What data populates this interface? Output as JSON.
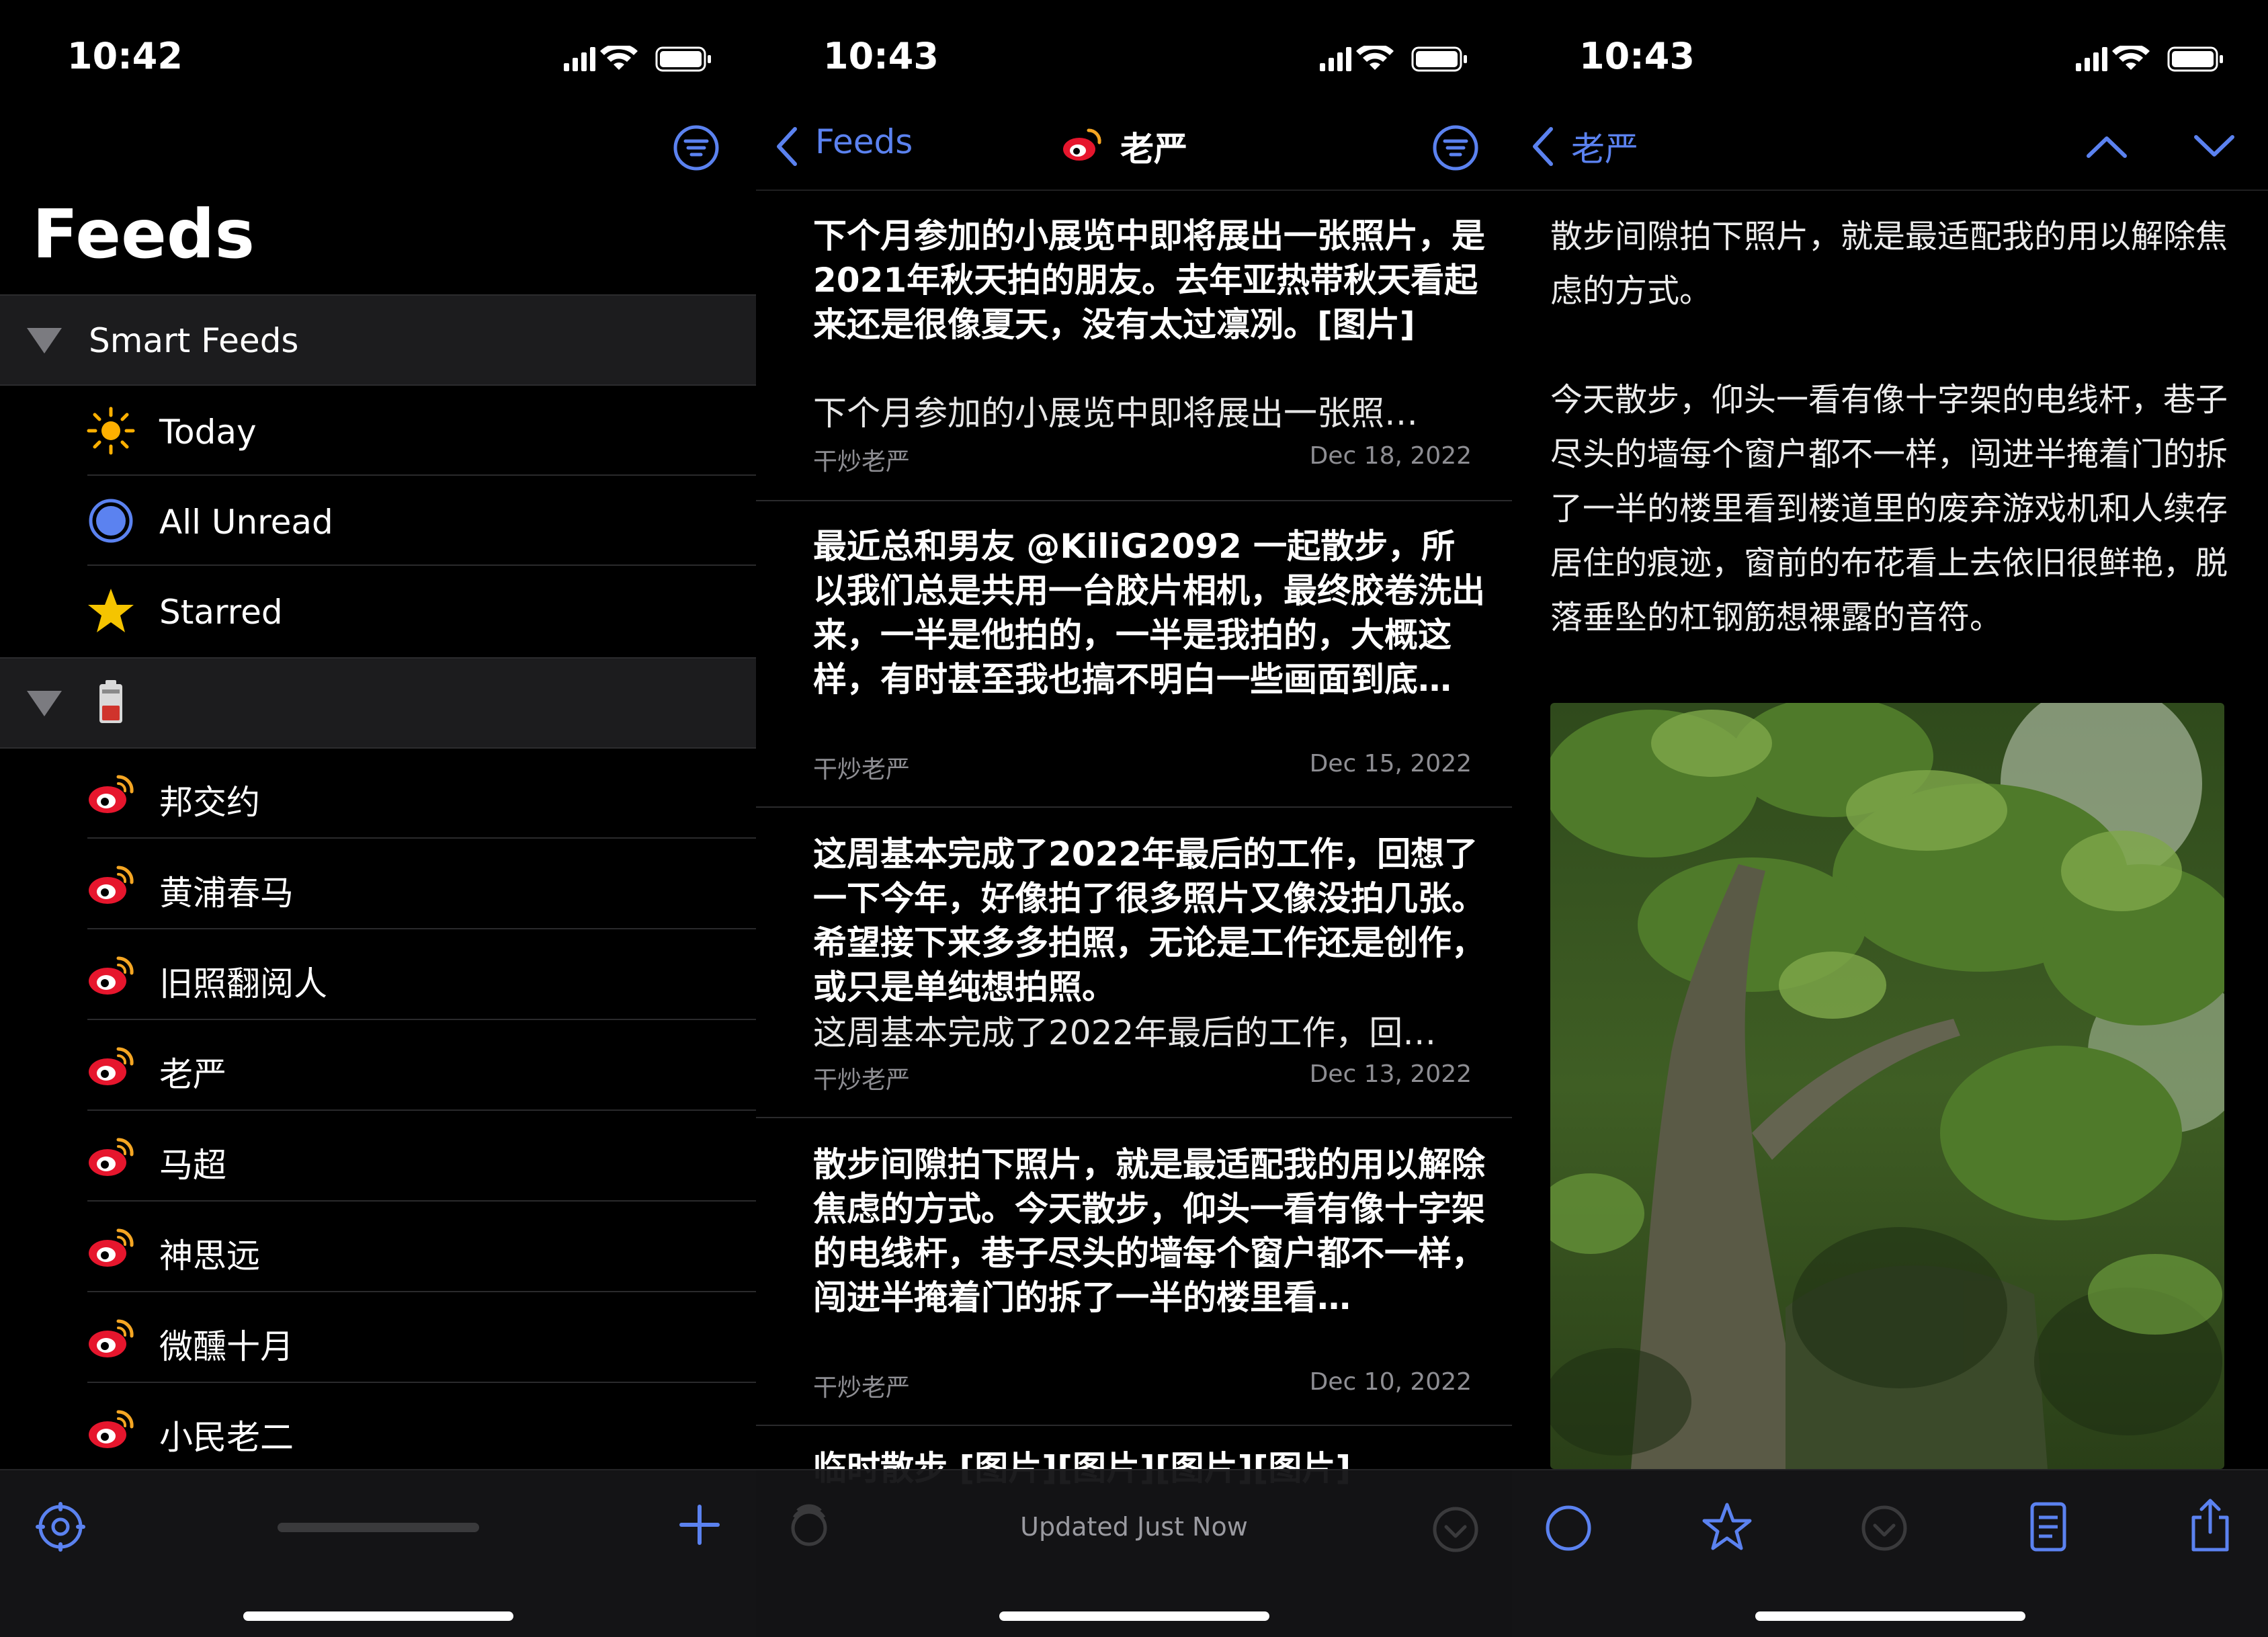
{
  "panel1": {
    "time": "10:42",
    "title": "Feeds",
    "smart_section": "Smart Feeds",
    "smart_items": [
      {
        "label": "Today",
        "icon": "sun-icon"
      },
      {
        "label": "All Unread",
        "icon": "circle-dot-icon"
      },
      {
        "label": "Starred",
        "icon": "star-icon"
      }
    ],
    "folder_items": [
      "邦交约",
      "黄浦春马",
      "旧照翻阅人",
      "老严",
      "马超",
      "神思远",
      "微醺十月",
      "小民老二"
    ]
  },
  "panel2": {
    "time": "10:43",
    "back_label": "Feeds",
    "title": "老严",
    "articles": [
      {
        "title": "下个月参加的小展览中即将展出一张照片，是2021年秋天拍的朋友。去年亚热带秋天看起来还是很像夏天，没有太过凛冽。[图片]",
        "summary": "下个月参加的小展览中即将展出一张照…",
        "source": "干炒老严",
        "date": "Dec 18, 2022"
      },
      {
        "title": "最近总和男友 @KiliG2092 一起散步，所以我们总是共用一台胶片相机，最终胶卷洗出来，一半是他拍的，一半是我拍的，大概这样，有时甚至我也搞不明白一些画面到底…",
        "summary": "",
        "source": "干炒老严",
        "date": "Dec 15, 2022"
      },
      {
        "title": "这周基本完成了2022年最后的工作，回想了一下今年，好像拍了很多照片又像没拍几张。希望接下来多多拍照，无论是工作还是创作，或只是单纯想拍照。",
        "summary": "这周基本完成了2022年最后的工作，回…",
        "source": "干炒老严",
        "date": "Dec 13, 2022"
      },
      {
        "title": "散步间隙拍下照片，就是最适配我的用以解除焦虑的方式。今天散步，仰头一看有像十字架的电线杆，巷子尽头的墙每个窗户都不一样，闯进半掩着门的拆了一半的楼里看…",
        "summary": "",
        "source": "干炒老严",
        "date": "Dec 10, 2022"
      },
      {
        "title": "临时散步 [图片][图片][图片][图片]",
        "summary": "",
        "source": "",
        "date": ""
      }
    ],
    "status": "Updated Just Now"
  },
  "panel3": {
    "time": "10:43",
    "back_label": "老严",
    "paragraph1": "散步间隙拍下照片，就是最适配我的用以解除焦虑的方式。",
    "paragraph2": "今天散步，仰头一看有像十字架的电线杆，巷子尽头的墙每个窗户都不一样，闯进半掩着门的拆了一半的楼里看到楼道里的废弃游戏机和人续存居住的痕迹，窗前的布花看上去依旧很鲜艳，脱落垂坠的杠钢筋想裸露的音符。"
  },
  "colors": {
    "accent": "#5b82f0",
    "background": "#000000",
    "section": "#1c1c1e",
    "secondary_text": "#8e8e93"
  }
}
